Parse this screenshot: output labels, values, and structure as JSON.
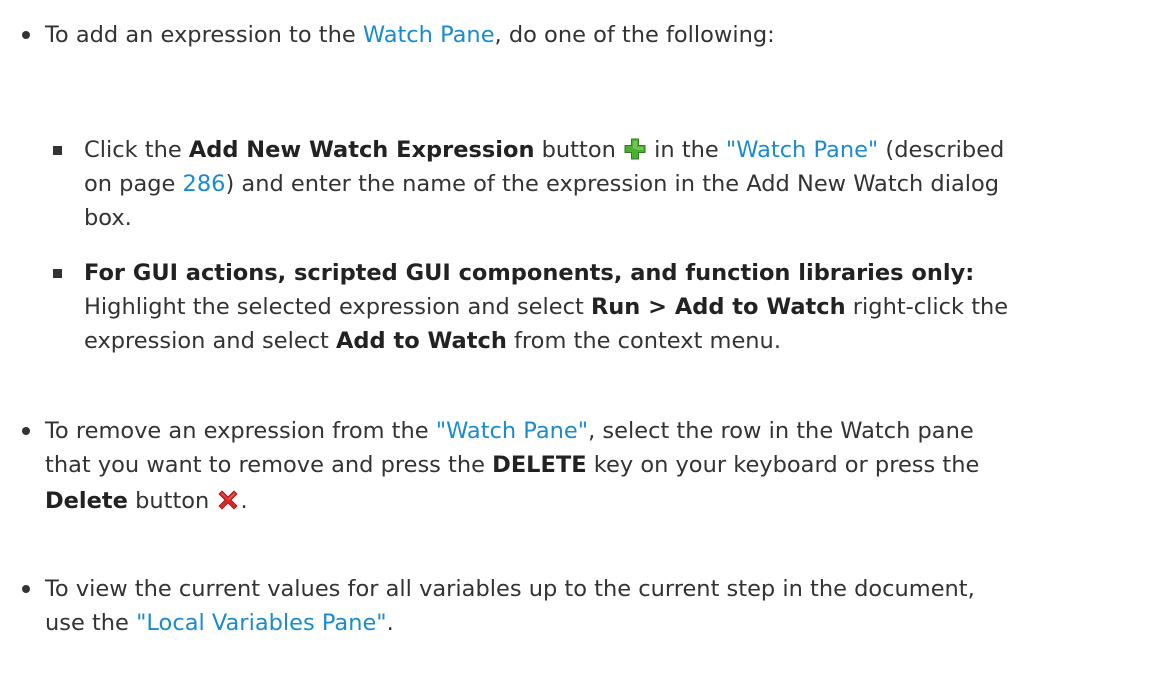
{
  "colors": {
    "text": "#333333",
    "link": "#1a8ccc",
    "add_icon": "#4caf34",
    "delete_icon": "#d8262a"
  },
  "item1": {
    "pre": "To add an expression to the ",
    "link": "Watch Pane",
    "post": ", do one of the following:",
    "sub1": {
      "a": "Click the ",
      "b_bold": "Add New Watch Expression",
      "c": " button ",
      "icon": "add-plus-icon",
      "d": " in the ",
      "link": "\"Watch Pane\"",
      "e": " (described",
      "f": "on page ",
      "page": "286",
      "g": ") and enter the name of the expression in the Add New Watch dialog",
      "h": "box."
    },
    "sub2": {
      "bold_line": "For GUI actions, scripted GUI components, and function libraries only:",
      "a": "Highlight the selected expression and select ",
      "b_bold": "Run > Add to Watch",
      "c": " right-click the",
      "d": "expression and select ",
      "e_bold": "Add to Watch",
      "f": " from the context menu."
    }
  },
  "item2": {
    "pre": "To remove an expression from the ",
    "link": "\"Watch Pane\"",
    "post": ", select the row in the Watch pane",
    "line2a": "that you want to remove and press the ",
    "line2_bold": "DELETE",
    "line2b": " key on your keyboard or press the",
    "line3_bold": "Delete",
    "line3a": " button ",
    "icon": "delete-x-icon",
    "line3b": "."
  },
  "item3": {
    "line1": "To view the current values for all variables up to the current step in the document,",
    "line2a": "use the ",
    "link": "\"Local Variables Pane\"",
    "line2b": "."
  }
}
